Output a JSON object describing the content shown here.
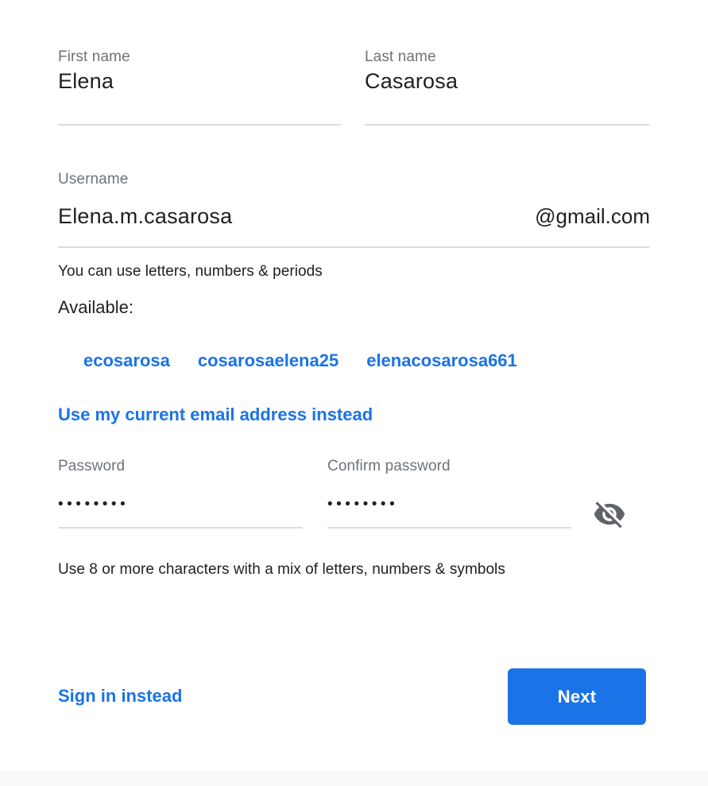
{
  "form": {
    "first_name": {
      "label": "First name",
      "value": "Elena",
      "placeholder": "First name"
    },
    "last_name": {
      "label": "Last name",
      "value": "Casarosa",
      "placeholder": "Last name"
    },
    "username": {
      "label": "Username",
      "value": "Elena.m.casarosa",
      "placeholder": "Username",
      "suffix": "@gmail.com",
      "helper": "You can use letters, numbers & periods"
    },
    "availability": {
      "label": "Available:",
      "suggestions": [
        "ecosarosa",
        "cosarosaelena25",
        "elenacosarosa661"
      ]
    },
    "use_current_email_link": "Use my current email address instead",
    "password": {
      "label": "Password",
      "value": "••••••••",
      "placeholder": "Password"
    },
    "confirm_password": {
      "label": "Confirm password",
      "value": "••••••••",
      "placeholder": "Confirm password"
    },
    "password_helper": "Use 8 or more characters with a mix of letters, numbers & symbols",
    "visibility_toggle_icon": "visibility-off-icon"
  },
  "actions": {
    "sign_in_instead_label": "Sign in instead",
    "next_label": "Next"
  },
  "colors": {
    "accent": "#1a73e8",
    "primary_button": "#1b73e8",
    "label_text": "#6e7378",
    "body_text": "#202124",
    "underline": "#dadce0"
  }
}
